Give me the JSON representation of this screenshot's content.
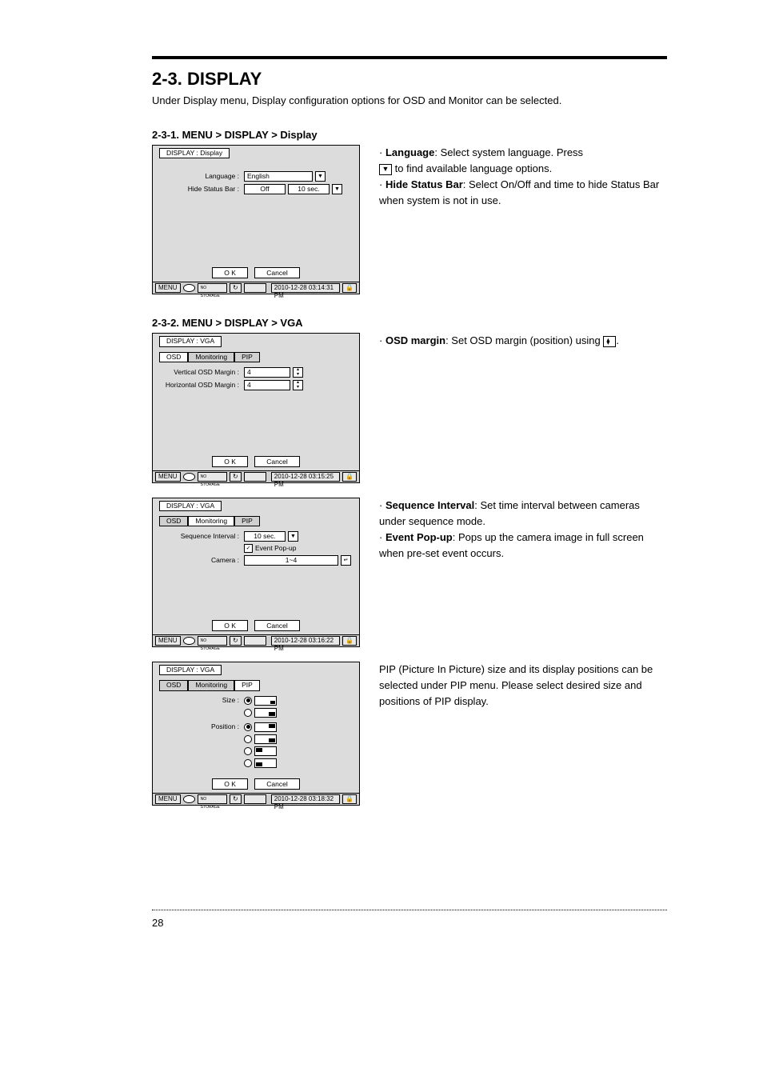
{
  "page_number": "28",
  "heading": "2-3. DISPLAY",
  "intro": "Under Display menu, Display configuration options for OSD and Monitor can be selected.",
  "sections": {
    "s1": {
      "title": "2-3-1. MENU > DISPLAY > Display",
      "panel_title": "DISPLAY : Display",
      "lang_label": "Language :",
      "lang_value": "English",
      "hide_label": "Hide Status Bar :",
      "hide_value1": "Off",
      "hide_value2": "10 sec.",
      "ok": "O K",
      "cancel": "Cancel",
      "menu": "MENU",
      "no_storage": "NO STORAGE",
      "timestamp": "2010-12-28 03:14:31 PM",
      "desc_lang_head": "Language",
      "desc_lang_body1": ": Select system language. Press",
      "desc_lang_body2": "to find available language options.",
      "desc_hide_head": "Hide Status Bar",
      "desc_hide_body": ": Select On/Off and time to hide Status Bar when system is not in use."
    },
    "s2": {
      "title": "2-3-2. MENU > DISPLAY > VGA",
      "panel_title": "DISPLAY : VGA",
      "tab_osd": "OSD",
      "tab_mon": "Monitoring",
      "tab_pip": "PIP",
      "vmargin_label": "Vertical OSD Margin :",
      "hmargin_label": "Horizontal OSD Margin :",
      "margin_value": "4",
      "seq_label": "Sequence Interval :",
      "seq_value": "10 sec.",
      "event_label": "Event Pop-up",
      "camera_label": "Camera :",
      "camera_value": "1~4",
      "size_label": "Size :",
      "pos_label": "Position :",
      "ok": "O K",
      "cancel": "Cancel",
      "menu": "MENU",
      "no_storage": "NO STORAGE",
      "ts1": "2010-12-28 03:15:25 PM",
      "ts2": "2010-12-28 03:16:22 PM",
      "ts3": "2010-12-28 03:18:32 PM",
      "desc_osd_head": "OSD margin",
      "desc_osd_body1": ": Set OSD margin (position) using",
      "desc_osd_body2": ".",
      "desc_seq_head": "Sequence Interval",
      "desc_seq_body": ": Set time interval between cameras under sequence mode.",
      "desc_evt_head": "Event Pop-up",
      "desc_evt_body": ": Pops up the camera image in full screen when pre-set event occurs.",
      "desc_pip": "PIP (Picture In Picture) size and its display positions can be selected under PIP menu. Please select desired size and positions of PIP display."
    }
  }
}
